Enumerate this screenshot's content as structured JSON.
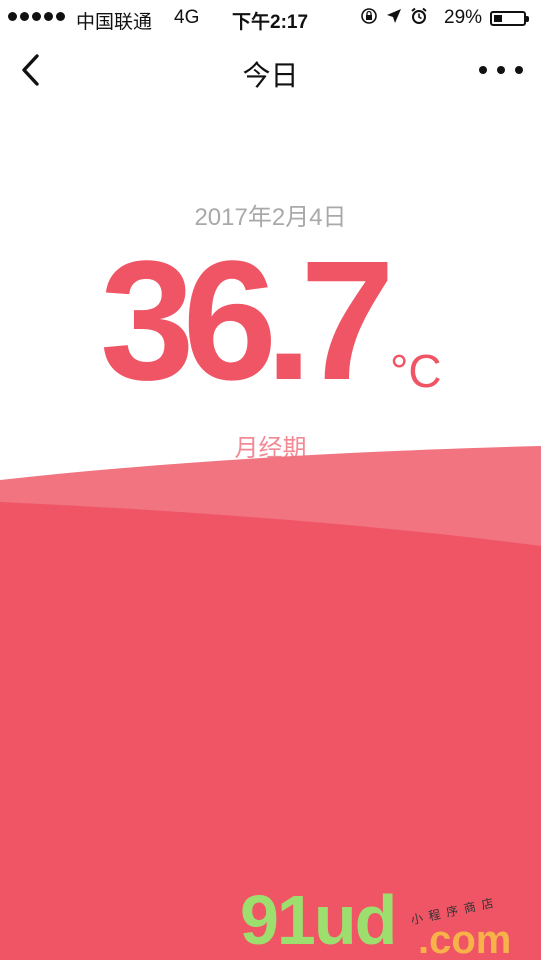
{
  "status_bar": {
    "carrier": "中国联通",
    "network": "4G",
    "time": "下午2:17",
    "battery_percent": "29%",
    "battery_level": 0.29,
    "icons": [
      "orientation-lock-icon",
      "location-arrow-icon",
      "alarm-icon"
    ]
  },
  "nav": {
    "title": "今日",
    "back_icon": "chevron-left-icon",
    "more_icon": "more-dots-icon"
  },
  "main": {
    "date": "2017年2月4日",
    "temperature": "36.7",
    "unit": "°C",
    "phase": "月经期"
  },
  "watermark": {
    "brand": "91ud",
    "suffix": ".com",
    "tagline": "小程序商店"
  },
  "colors": {
    "accent": "#ef5565",
    "wave_light": "#f17480",
    "wave_dark": "#ef5565",
    "date_gray": "#a9a9a9",
    "phase_pink": "#f28a95"
  }
}
